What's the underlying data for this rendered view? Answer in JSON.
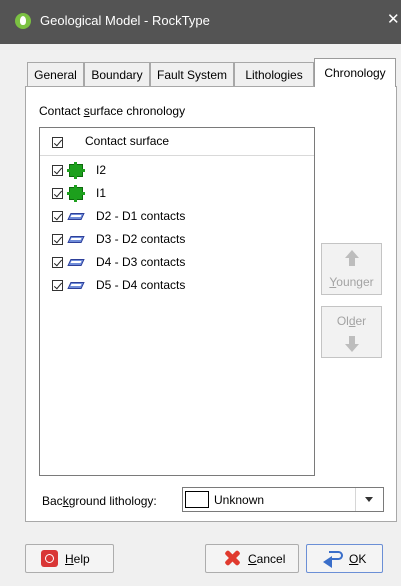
{
  "window": {
    "title": "Geological Model - RockType",
    "close_glyph": "✕",
    "icon": "leapfrog-app-icon"
  },
  "tabs": [
    {
      "label": "General",
      "active": false
    },
    {
      "label": "Boundary",
      "active": false
    },
    {
      "label": "Fault System",
      "active": false
    },
    {
      "label": "Lithologies",
      "active": false
    },
    {
      "label": "Chronology",
      "active": true
    }
  ],
  "chronology": {
    "section_label_pre": "Contact ",
    "section_label_key": "s",
    "section_label_post": "urface chronology",
    "list": {
      "header_checked": true,
      "header_label": "Contact surface",
      "items": [
        {
          "label": "I2",
          "checked": true,
          "icon": "intrusion-icon"
        },
        {
          "label": "I1",
          "checked": true,
          "icon": "intrusion-icon"
        },
        {
          "label": "D2 - D1 contacts",
          "checked": true,
          "icon": "surface-icon"
        },
        {
          "label": "D3 - D2 contacts",
          "checked": true,
          "icon": "surface-icon"
        },
        {
          "label": "D4 - D3 contacts",
          "checked": true,
          "icon": "surface-icon"
        },
        {
          "label": "D5 - D4 contacts",
          "checked": true,
          "icon": "surface-icon"
        }
      ]
    },
    "younger_button": {
      "key": "Y",
      "rest": "ounger",
      "enabled": false
    },
    "older_button": {
      "pre": "Ol",
      "key": "d",
      "post": "er",
      "enabled": false
    }
  },
  "background_lithology": {
    "label_pre": "Bac",
    "label_key": "k",
    "label_post": "ground lithology:",
    "value": "Unknown",
    "swatch_color": "#ffffff"
  },
  "buttons": {
    "help": {
      "key": "H",
      "rest": "elp"
    },
    "cancel": {
      "key": "C",
      "rest": "ancel"
    },
    "ok": {
      "key": "O",
      "rest": "K"
    }
  },
  "colors": {
    "titlebar": "#545454",
    "intrusion_icon": "#1da01d",
    "surface_icon": "#6f8cd9"
  }
}
